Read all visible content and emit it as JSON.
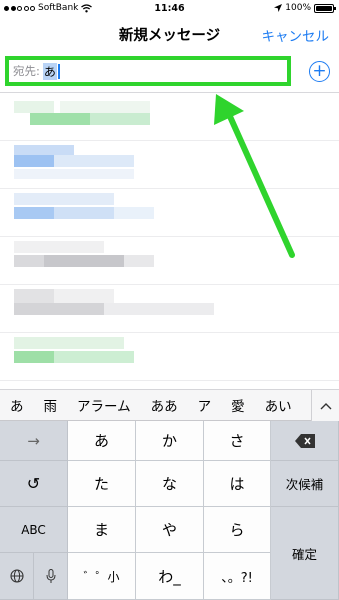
{
  "status_bar": {
    "carrier": "SoftBank",
    "time": "11:46",
    "battery": "100%",
    "battery_level": 1.0
  },
  "nav": {
    "title": "新規メッセージ",
    "cancel_label": "キャンセル"
  },
  "to_field": {
    "label": "宛先:",
    "value": "あ"
  },
  "suggestions_count": 5,
  "candidates": [
    "あ",
    "雨",
    "アラーム",
    "ああ",
    "ア",
    "愛",
    "あい"
  ],
  "keyboard": {
    "arrow": "→",
    "undo": "↺",
    "abc": "ABC",
    "globe": "🌐",
    "mic": "🎤",
    "next_candidate": "次候補",
    "confirm": "確定",
    "keys": [
      "あ",
      "か",
      "さ",
      "た",
      "な",
      "は",
      "ま",
      "や",
      "ら",
      "゛゜小",
      "わ_",
      "、。?!"
    ]
  },
  "colors": {
    "accent_blue": "#1d7cf2",
    "highlight_green": "#2fd42d"
  }
}
